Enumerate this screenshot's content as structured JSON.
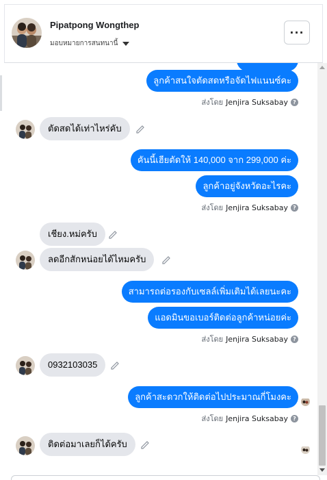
{
  "header": {
    "name": "Pipatpong Wongthep",
    "assign_label": "มอบหมายการสนทนานี้",
    "more_label": "···"
  },
  "messages": [
    {
      "dir": "out",
      "text": "ลูกค้าสนใจตัดสดหรือจัดไฟแนนซ์คะ"
    },
    {
      "dir": "sentby",
      "prefix": "ส่งโดย",
      "agent": "Jenjira Suksabay"
    },
    {
      "dir": "in",
      "text": "ตัดสดได้เท่าไหร่คับ"
    },
    {
      "dir": "out",
      "text": "คันนี้เฮียตัดให้ 140,000 จาก 299,000 ค่ะ"
    },
    {
      "dir": "out",
      "text": "ลูกค้าอยู่จังหวัดอะไรคะ"
    },
    {
      "dir": "sentby",
      "prefix": "ส่งโดย",
      "agent": "Jenjira Suksabay"
    },
    {
      "dir": "in",
      "text": "เชียง.หม่ครับ"
    },
    {
      "dir": "in",
      "text": "ลดอีกสักหน่อยได้ไหมครับ"
    },
    {
      "dir": "out",
      "text": "สามารถต่อรองกับเซลล์เพิ่มเติมได้เลยนะคะ"
    },
    {
      "dir": "out",
      "text": "แอดมินขอเบอร์ติดต่อลูกค้าหน่อยค่ะ"
    },
    {
      "dir": "sentby",
      "prefix": "ส่งโดย",
      "agent": "Jenjira Suksabay"
    },
    {
      "dir": "in",
      "text": "0932103035"
    },
    {
      "dir": "out",
      "text": "ลูกค้าสะดวกให้ติดต่อไปประมาณกี่โมงคะ"
    },
    {
      "dir": "sentby",
      "prefix": "ส่งโดย",
      "agent": "Jenjira Suksabay"
    },
    {
      "dir": "in",
      "text": "ติดต่อมาเลยก็ได้ครับ"
    }
  ],
  "colors": {
    "outgoing_bubble": "#0a7cff",
    "incoming_bubble": "#e4e6eb"
  },
  "icons": {
    "edit": "pencil-icon",
    "help": "help-icon",
    "more": "more-icon"
  },
  "help_glyph": "?"
}
